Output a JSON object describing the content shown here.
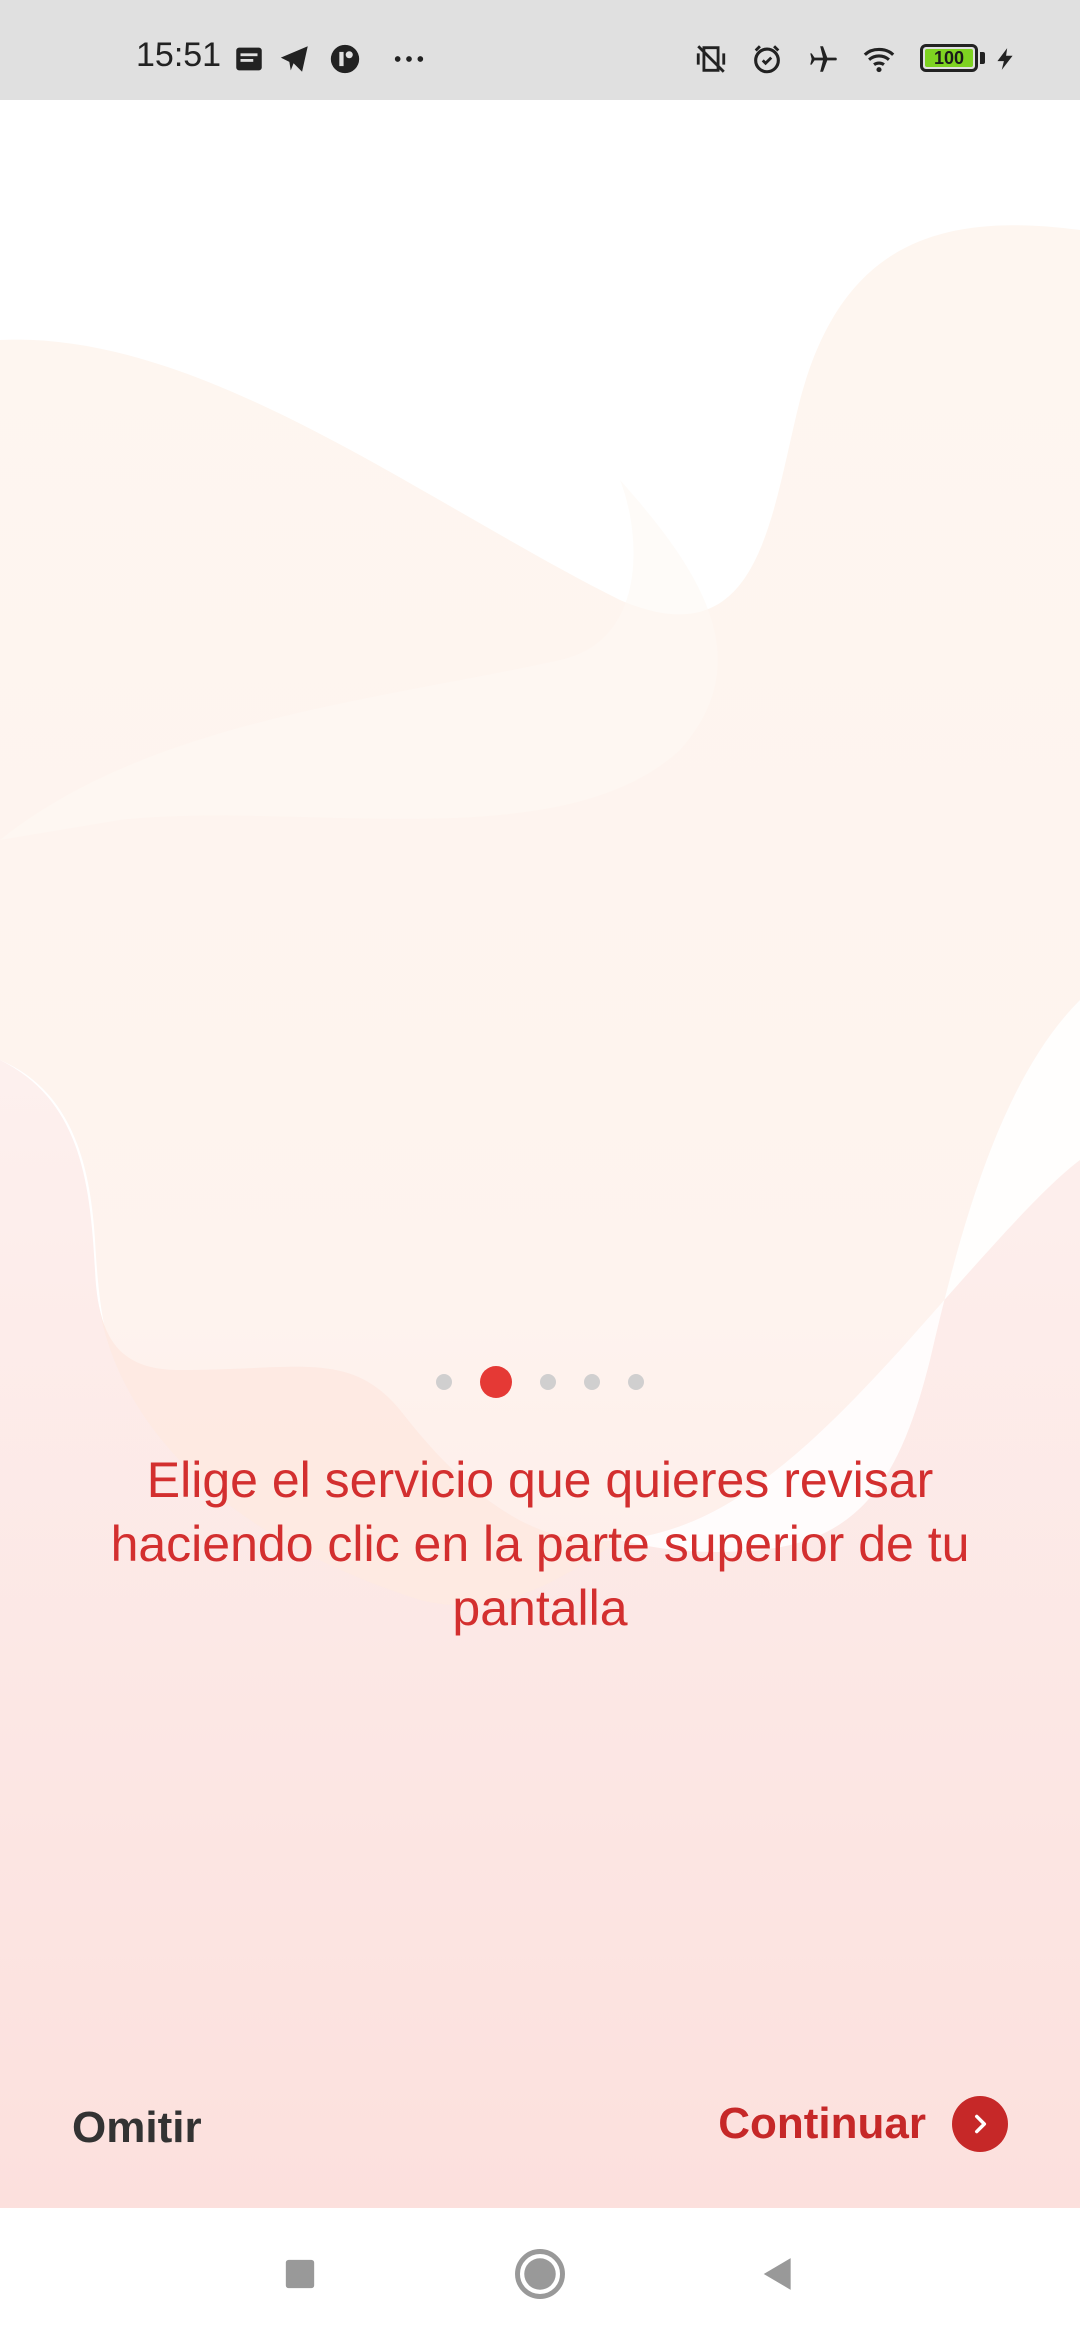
{
  "status_bar": {
    "time": "15:51",
    "battery_level": "100",
    "icons": [
      "message-icon",
      "telegram-icon",
      "app-icon",
      "more-dots-icon",
      "vibrate-off-icon",
      "alarm-icon",
      "airplane-icon",
      "wifi-icon",
      "battery-icon",
      "charging-icon"
    ]
  },
  "onboarding": {
    "pages_total": 5,
    "active_page": 2,
    "message": "Elige el servicio que quieres revisar haciendo clic en la parte superior de tu pantalla"
  },
  "actions": {
    "skip_label": "Omitir",
    "continue_label": "Continuar"
  },
  "navigation": {
    "buttons": [
      "recents-icon",
      "home-icon",
      "back-icon"
    ]
  },
  "colors": {
    "accent": "#c62828",
    "text_accent": "#d32f2f",
    "active_dot": "#e53935",
    "inactive_dot": "#d0cfcf"
  }
}
